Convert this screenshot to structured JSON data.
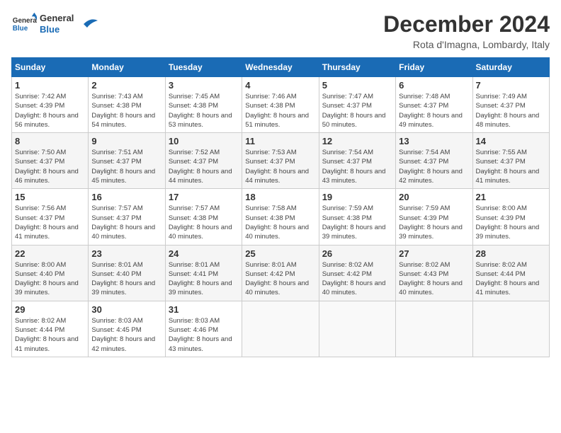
{
  "header": {
    "logo_general": "General",
    "logo_blue": "Blue",
    "month_title": "December 2024",
    "location": "Rota d'Imagna, Lombardy, Italy"
  },
  "weekdays": [
    "Sunday",
    "Monday",
    "Tuesday",
    "Wednesday",
    "Thursday",
    "Friday",
    "Saturday"
  ],
  "weeks": [
    [
      {
        "day": "1",
        "sunrise": "7:42 AM",
        "sunset": "4:39 PM",
        "daylight": "8 hours and 56 minutes."
      },
      {
        "day": "2",
        "sunrise": "7:43 AM",
        "sunset": "4:38 PM",
        "daylight": "8 hours and 54 minutes."
      },
      {
        "day": "3",
        "sunrise": "7:45 AM",
        "sunset": "4:38 PM",
        "daylight": "8 hours and 53 minutes."
      },
      {
        "day": "4",
        "sunrise": "7:46 AM",
        "sunset": "4:38 PM",
        "daylight": "8 hours and 51 minutes."
      },
      {
        "day": "5",
        "sunrise": "7:47 AM",
        "sunset": "4:37 PM",
        "daylight": "8 hours and 50 minutes."
      },
      {
        "day": "6",
        "sunrise": "7:48 AM",
        "sunset": "4:37 PM",
        "daylight": "8 hours and 49 minutes."
      },
      {
        "day": "7",
        "sunrise": "7:49 AM",
        "sunset": "4:37 PM",
        "daylight": "8 hours and 48 minutes."
      }
    ],
    [
      {
        "day": "8",
        "sunrise": "7:50 AM",
        "sunset": "4:37 PM",
        "daylight": "8 hours and 46 minutes."
      },
      {
        "day": "9",
        "sunrise": "7:51 AM",
        "sunset": "4:37 PM",
        "daylight": "8 hours and 45 minutes."
      },
      {
        "day": "10",
        "sunrise": "7:52 AM",
        "sunset": "4:37 PM",
        "daylight": "8 hours and 44 minutes."
      },
      {
        "day": "11",
        "sunrise": "7:53 AM",
        "sunset": "4:37 PM",
        "daylight": "8 hours and 44 minutes."
      },
      {
        "day": "12",
        "sunrise": "7:54 AM",
        "sunset": "4:37 PM",
        "daylight": "8 hours and 43 minutes."
      },
      {
        "day": "13",
        "sunrise": "7:54 AM",
        "sunset": "4:37 PM",
        "daylight": "8 hours and 42 minutes."
      },
      {
        "day": "14",
        "sunrise": "7:55 AM",
        "sunset": "4:37 PM",
        "daylight": "8 hours and 41 minutes."
      }
    ],
    [
      {
        "day": "15",
        "sunrise": "7:56 AM",
        "sunset": "4:37 PM",
        "daylight": "8 hours and 41 minutes."
      },
      {
        "day": "16",
        "sunrise": "7:57 AM",
        "sunset": "4:37 PM",
        "daylight": "8 hours and 40 minutes."
      },
      {
        "day": "17",
        "sunrise": "7:57 AM",
        "sunset": "4:38 PM",
        "daylight": "8 hours and 40 minutes."
      },
      {
        "day": "18",
        "sunrise": "7:58 AM",
        "sunset": "4:38 PM",
        "daylight": "8 hours and 40 minutes."
      },
      {
        "day": "19",
        "sunrise": "7:59 AM",
        "sunset": "4:38 PM",
        "daylight": "8 hours and 39 minutes."
      },
      {
        "day": "20",
        "sunrise": "7:59 AM",
        "sunset": "4:39 PM",
        "daylight": "8 hours and 39 minutes."
      },
      {
        "day": "21",
        "sunrise": "8:00 AM",
        "sunset": "4:39 PM",
        "daylight": "8 hours and 39 minutes."
      }
    ],
    [
      {
        "day": "22",
        "sunrise": "8:00 AM",
        "sunset": "4:40 PM",
        "daylight": "8 hours and 39 minutes."
      },
      {
        "day": "23",
        "sunrise": "8:01 AM",
        "sunset": "4:40 PM",
        "daylight": "8 hours and 39 minutes."
      },
      {
        "day": "24",
        "sunrise": "8:01 AM",
        "sunset": "4:41 PM",
        "daylight": "8 hours and 39 minutes."
      },
      {
        "day": "25",
        "sunrise": "8:01 AM",
        "sunset": "4:42 PM",
        "daylight": "8 hours and 40 minutes."
      },
      {
        "day": "26",
        "sunrise": "8:02 AM",
        "sunset": "4:42 PM",
        "daylight": "8 hours and 40 minutes."
      },
      {
        "day": "27",
        "sunrise": "8:02 AM",
        "sunset": "4:43 PM",
        "daylight": "8 hours and 40 minutes."
      },
      {
        "day": "28",
        "sunrise": "8:02 AM",
        "sunset": "4:44 PM",
        "daylight": "8 hours and 41 minutes."
      }
    ],
    [
      {
        "day": "29",
        "sunrise": "8:02 AM",
        "sunset": "4:44 PM",
        "daylight": "8 hours and 41 minutes."
      },
      {
        "day": "30",
        "sunrise": "8:03 AM",
        "sunset": "4:45 PM",
        "daylight": "8 hours and 42 minutes."
      },
      {
        "day": "31",
        "sunrise": "8:03 AM",
        "sunset": "4:46 PM",
        "daylight": "8 hours and 43 minutes."
      },
      null,
      null,
      null,
      null
    ]
  ],
  "labels": {
    "sunrise": "Sunrise:",
    "sunset": "Sunset:",
    "daylight": "Daylight:"
  }
}
